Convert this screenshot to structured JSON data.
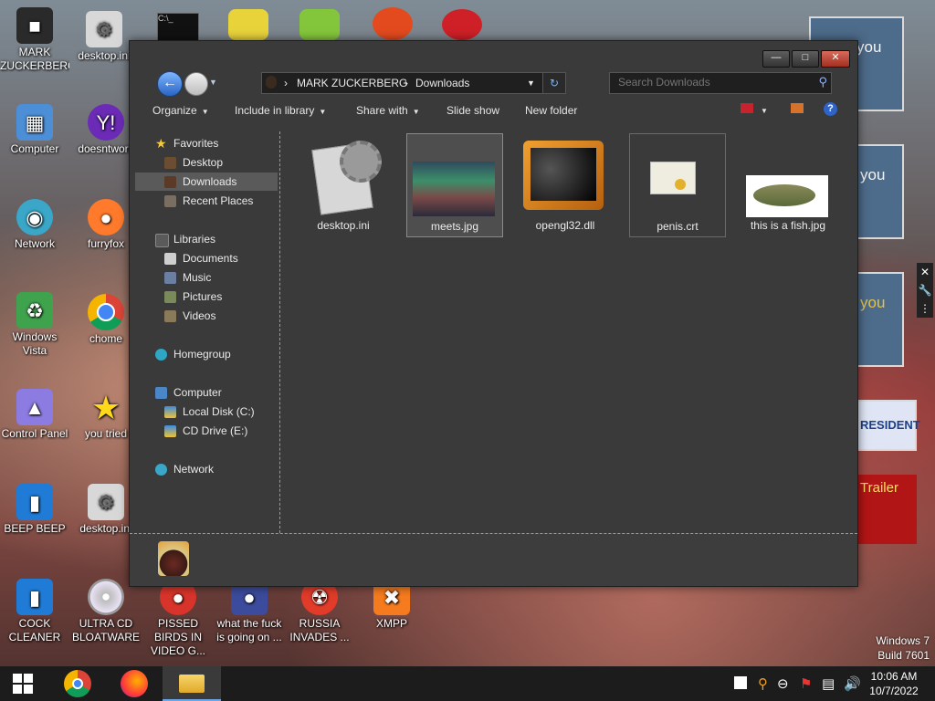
{
  "desktop": {
    "icons": [
      {
        "label": "MARK ZUCKERBERG",
        "icon": "user-folder-icon"
      },
      {
        "label": "desktop.ini",
        "icon": "settings-file-icon"
      },
      {
        "label": "Computer",
        "icon": "computer-icon"
      },
      {
        "label": "doesntwork",
        "icon": "yahoo-icon"
      },
      {
        "label": "Network",
        "icon": "network-icon"
      },
      {
        "label": "furryfox",
        "icon": "firefox-icon"
      },
      {
        "label": "Windows Vista",
        "icon": "recycle-bin-icon"
      },
      {
        "label": "chome",
        "icon": "chrome-icon"
      },
      {
        "label": "Control Panel",
        "icon": "control-panel-icon"
      },
      {
        "label": "you tried",
        "icon": "star-icon"
      },
      {
        "label": "BEEP BEEP",
        "icon": "blue-app-icon"
      },
      {
        "label": "desktop.ini",
        "icon": "settings-file-icon"
      },
      {
        "label": "COCK CLEANER",
        "icon": "blue-app-icon"
      },
      {
        "label": "ULTRA CD BLOATWARE",
        "icon": "cd-icon"
      },
      {
        "label": "PISSED BIRDS IN VIDEO G...",
        "icon": "angry-bird-icon"
      },
      {
        "label": "what the fuck is going on ...",
        "icon": "angry-bird-space-icon"
      },
      {
        "label": "RUSSIA INVADES ...",
        "icon": "radiation-icon"
      },
      {
        "label": "XMPP",
        "icon": "xampp-icon"
      }
    ]
  },
  "ads": {
    "items": [
      {
        "text": "you"
      },
      {
        "text": "you"
      },
      {
        "text": "you"
      },
      {
        "text": "RESIDENT"
      },
      {
        "text": "Trailer"
      }
    ]
  },
  "explorer": {
    "address": {
      "root": "MARK ZUCKERBERG",
      "current": "Downloads"
    },
    "search_placeholder": "Search Downloads",
    "toolbar": {
      "organize": "Organize",
      "include": "Include in library",
      "share": "Share with",
      "slideshow": "Slide show",
      "newfolder": "New folder"
    },
    "nav": {
      "favorites": "Favorites",
      "desktop": "Desktop",
      "downloads": "Downloads",
      "recent": "Recent Places",
      "libraries": "Libraries",
      "documents": "Documents",
      "music": "Music",
      "pictures": "Pictures",
      "videos": "Videos",
      "homegroup": "Homegroup",
      "computer": "Computer",
      "localdisk": "Local Disk (C:)",
      "cddrive": "CD Drive (E:)",
      "network": "Network"
    },
    "files": [
      {
        "name": "desktop.ini"
      },
      {
        "name": "meets.jpg"
      },
      {
        "name": "opengl32.dll"
      },
      {
        "name": "penis.crt"
      },
      {
        "name": "this is a fish.jpg"
      }
    ]
  },
  "watermark": {
    "line1": "Windows 7",
    "line2": "Build 7601"
  },
  "clock": {
    "time": "10:06 AM",
    "date": "10/7/2022"
  }
}
